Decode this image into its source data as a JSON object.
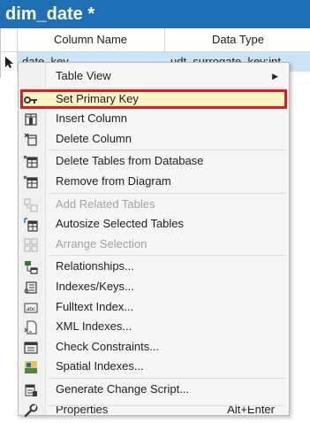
{
  "designer": {
    "title": "dim_date *",
    "columns": [
      "Column Name",
      "Data Type"
    ],
    "row": {
      "name": "date_key",
      "type": "udt_surrogate_key:int"
    }
  },
  "menu": {
    "items": [
      {
        "label": "Table View",
        "icon": "none",
        "submenu": true
      },
      {
        "label": "Set Primary Key",
        "icon": "key-icon",
        "highlighted": true
      },
      {
        "label": "Insert Column",
        "icon": "insert-column-icon"
      },
      {
        "label": "Delete Column",
        "icon": "delete-column-icon"
      },
      {
        "label": "Delete Tables from Database",
        "icon": "delete-table-icon"
      },
      {
        "label": "Remove from Diagram",
        "icon": "remove-table-icon"
      },
      {
        "label": "Add Related Tables",
        "icon": "add-related-tables-icon",
        "disabled": true
      },
      {
        "label": "Autosize Selected Tables",
        "icon": "autosize-icon"
      },
      {
        "label": "Arrange Selection",
        "icon": "arrange-icon",
        "disabled": true
      },
      {
        "label": "Relationships...",
        "icon": "relationships-icon"
      },
      {
        "label": "Indexes/Keys...",
        "icon": "indexes-icon"
      },
      {
        "label": "Fulltext Index...",
        "icon": "fulltext-icon"
      },
      {
        "label": "XML Indexes...",
        "icon": "xml-icon"
      },
      {
        "label": "Check Constraints...",
        "icon": "check-constraints-icon"
      },
      {
        "label": "Spatial Indexes...",
        "icon": "spatial-icon"
      },
      {
        "label": "Generate Change Script...",
        "icon": "script-icon"
      },
      {
        "label": "Properties",
        "icon": "wrench-icon",
        "shortcut": "Alt+Enter"
      }
    ]
  },
  "colors": {
    "title_bar": "#1f6fb5",
    "selected_row": "#cce4f7",
    "highlight_border": "#d92027",
    "highlight_fill": "#fdf3c7"
  }
}
